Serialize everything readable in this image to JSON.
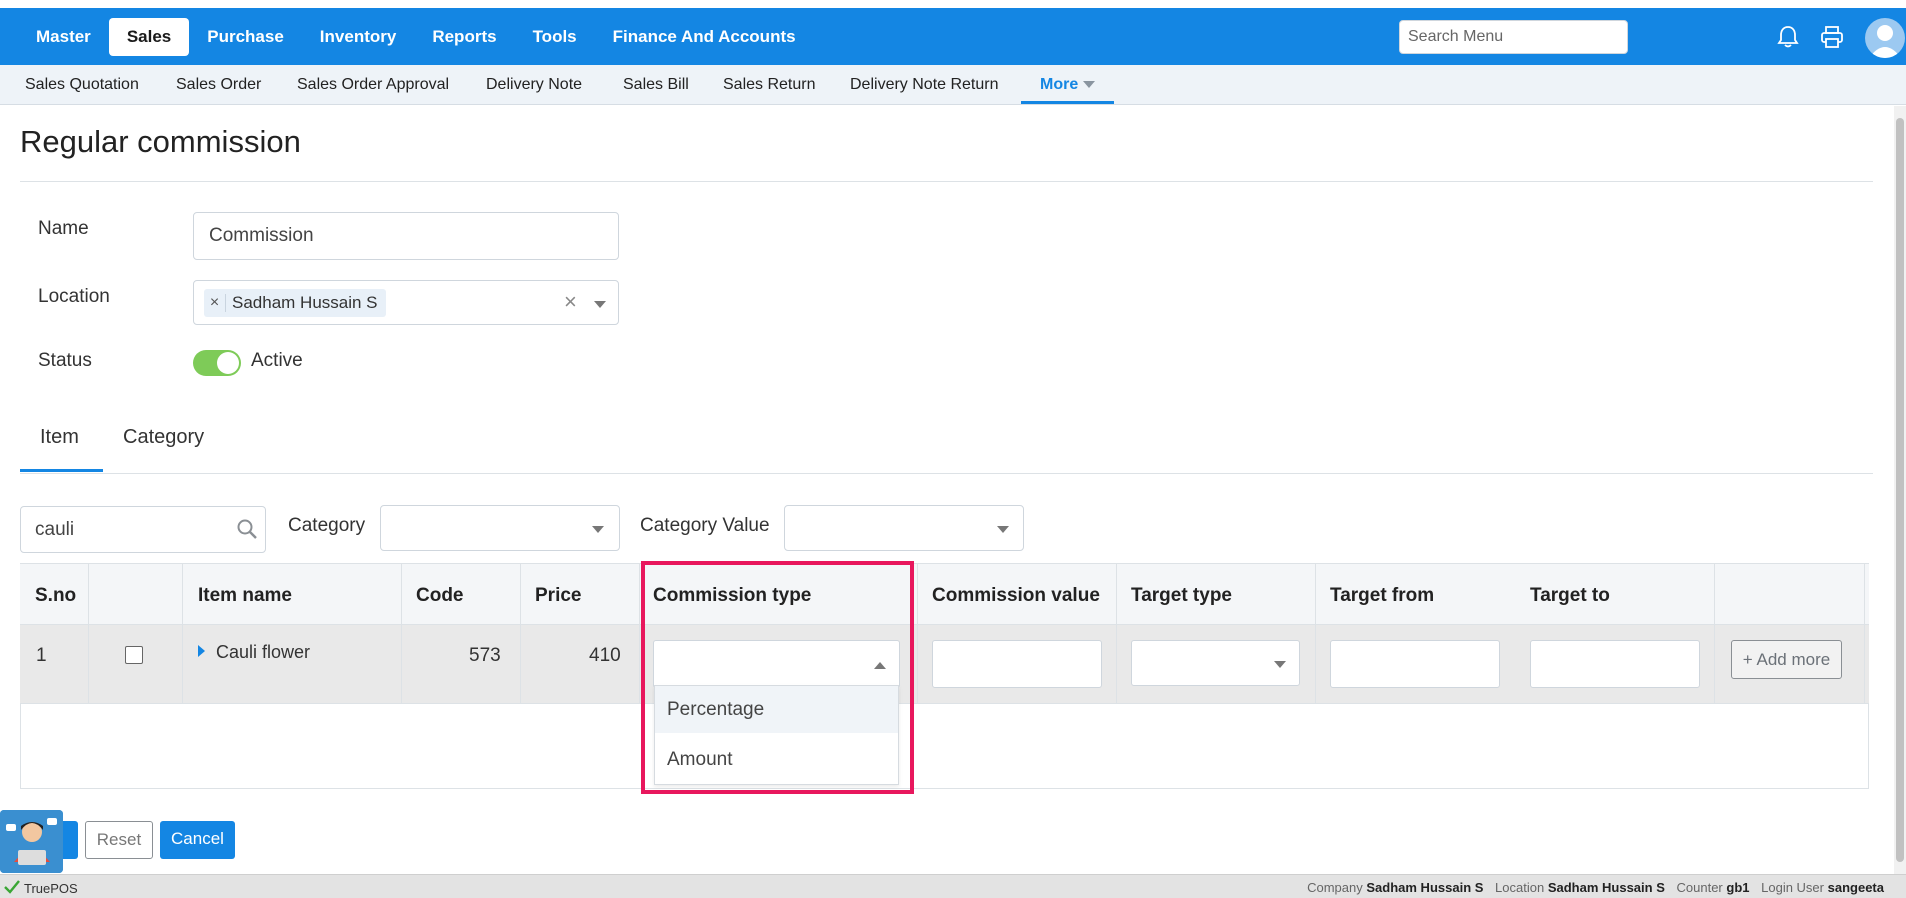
{
  "topnav": {
    "items": [
      "Master",
      "Sales",
      "Purchase",
      "Inventory",
      "Reports",
      "Tools",
      "Finance And Accounts"
    ],
    "active": "Sales",
    "search_placeholder": "Search Menu",
    "icons": [
      "bell-icon",
      "printer-icon",
      "user-avatar"
    ]
  },
  "subnav": {
    "items": [
      "Sales Quotation",
      "Sales Order",
      "Sales Order Approval",
      "Delivery Note",
      "Sales Bill",
      "Sales Return",
      "Delivery Note Return"
    ],
    "more_label": "More"
  },
  "page": {
    "title": "Regular commission"
  },
  "form": {
    "name_label": "Name",
    "name_value": "Commission",
    "location_label": "Location",
    "location_chip": "Sadham Hussain S",
    "chip_remove": "×",
    "clear_all": "×",
    "status_label": "Status",
    "status_value": "Active",
    "status_on": true
  },
  "tabs": {
    "item": "Item",
    "category": "Category",
    "active": "Item"
  },
  "filters": {
    "search_value": "cauli",
    "category_label": "Category",
    "category_value": "",
    "category_value_label": "Category Value",
    "category_value_value": ""
  },
  "table": {
    "headers": {
      "sno": "S.no",
      "select": "",
      "item_name": "Item name",
      "code": "Code",
      "price": "Price",
      "commission_type": "Commission type",
      "commission_value": "Commission value",
      "target_type": "Target type",
      "target_from": "Target from",
      "target_to": "Target to"
    },
    "rows": [
      {
        "sno": "1",
        "item_name": "Cauli flower",
        "code": "573",
        "price": "410",
        "checked": false,
        "add_more": "+ Add more"
      }
    ]
  },
  "dropdown": {
    "options": [
      "Percentage",
      "Amount"
    ],
    "highlighted": "Percentage",
    "annotation_color": "#e8175d"
  },
  "actions": {
    "reset": "Reset",
    "cancel": "Cancel"
  },
  "statusbar": {
    "app_name": "TruePOS",
    "company_label": "Company",
    "company_value": "Sadham Hussain S",
    "location_label": "Location",
    "location_value": "Sadham Hussain S",
    "counter_label": "Counter",
    "counter_value": "gb1",
    "login_label": "Login User",
    "login_value": "sangeeta"
  },
  "colors": {
    "primary": "#1486e3",
    "toggle_on": "#7ecb58",
    "highlight": "#e8175d"
  }
}
